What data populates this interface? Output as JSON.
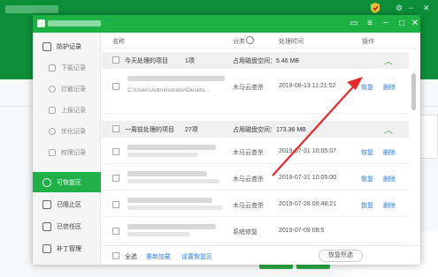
{
  "sidebar": {
    "items": [
      {
        "label": "防护记录",
        "icon": "shield-log-icon"
      },
      {
        "label": "下载记录",
        "icon": "download-icon"
      },
      {
        "label": "拦截记录",
        "icon": "block-icon"
      },
      {
        "label": "上报记录",
        "icon": "upload-icon"
      },
      {
        "label": "优化记录",
        "icon": "optimize-icon"
      },
      {
        "label": "权限记录",
        "icon": "permission-icon"
      },
      {
        "label": "可恢复区",
        "icon": "restore-area-icon"
      },
      {
        "label": "已阻止区",
        "icon": "blocked-icon"
      },
      {
        "label": "已信任区",
        "icon": "trust-icon"
      },
      {
        "label": "补丁管理",
        "icon": "patch-icon"
      }
    ]
  },
  "table": {
    "headers": {
      "name": "名称",
      "category": "分类",
      "time": "处理时间",
      "action": "操作"
    },
    "groups": [
      {
        "title": "今天处理的项目",
        "count": "1项",
        "space": "占用磁盘空间：5.46 MB"
      },
      {
        "title": "一周前处理的项目",
        "count": "27项",
        "space": "占用磁盘空间：173.36 MB"
      }
    ],
    "rows": [
      {
        "path": "C:\\Users\\Administrator\\Deskto...",
        "category": "木马云查杀",
        "time": "2019-08-13 11:21:52",
        "restore": "恢复",
        "delete": "删除"
      },
      {
        "path": "",
        "category": "木马云查杀",
        "time": "2019-07-31 10:05:07",
        "restore": "恢复",
        "delete": "删除"
      },
      {
        "path": "",
        "category": "木马云查杀",
        "time": "2019-07-31 10:05:00",
        "restore": "恢复",
        "delete": "删除"
      },
      {
        "path": "",
        "category": "木马云查杀",
        "time": "2019-07-28 09:48:21",
        "restore": "恢复",
        "delete": "删除"
      },
      {
        "path": "",
        "category": "系统修复",
        "time": "2019-07-09 08:5",
        "restore": "",
        "delete": ""
      }
    ]
  },
  "footer": {
    "select_all": "全选",
    "reload": "重新加载",
    "set_restore_area": "设置恢复区",
    "restore_selected": "恢复所选"
  },
  "colors": {
    "brand_green": "#1db045",
    "link_blue": "#2a7fd9",
    "arrow_red": "#e52a2a"
  }
}
